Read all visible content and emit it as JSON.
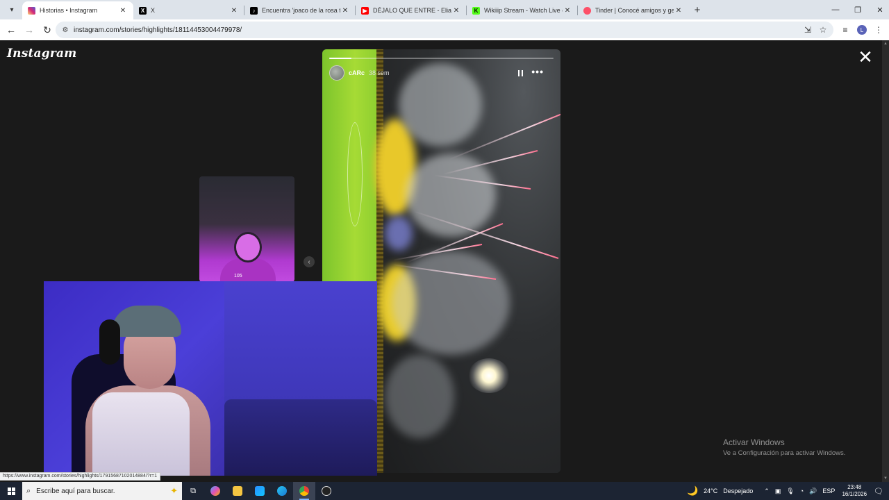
{
  "browser": {
    "tabs": [
      {
        "title": "Historias • Instagram",
        "icon": "instagram-icon",
        "color": "#d62976",
        "active": true
      },
      {
        "title": "X",
        "icon": "x-icon",
        "color": "#000000",
        "active": false
      },
      {
        "title": "Encuentra 'joaco de la rosa tem",
        "icon": "tiktok-icon",
        "color": "#000000",
        "active": false
      },
      {
        "title": "DÉJALO QUE ENTRE - Elian G (A",
        "icon": "youtube-icon",
        "color": "#ff0000",
        "active": false
      },
      {
        "title": "Wikiiip Stream - Watch Live on",
        "icon": "kick-icon",
        "color": "#53fc18",
        "active": false
      },
      {
        "title": "Tinder | Conocé amigos y gente",
        "icon": "tinder-icon",
        "color": "#fd5068",
        "active": false
      }
    ],
    "url": "instagram.com/stories/highlights/18114453004479978/",
    "profile_initial": "L"
  },
  "instagram": {
    "logo": "Instagram",
    "story": {
      "username": "cARc",
      "time": "38 sem",
      "progress": 0.1
    },
    "preview_label": "105"
  },
  "status_link": "https://www.instagram.com/stories/highlights/17915687102014884/?r=1",
  "windows_watermark": {
    "title": "Activar Windows",
    "subtitle": "Ve a Configuración para activar Windows."
  },
  "taskbar": {
    "search_placeholder": "Escribe aquí para buscar.",
    "weather_temp": "24°C",
    "weather_text": "Despejado",
    "language": "ESP",
    "time": "23:48",
    "date": "16/1/2026"
  }
}
